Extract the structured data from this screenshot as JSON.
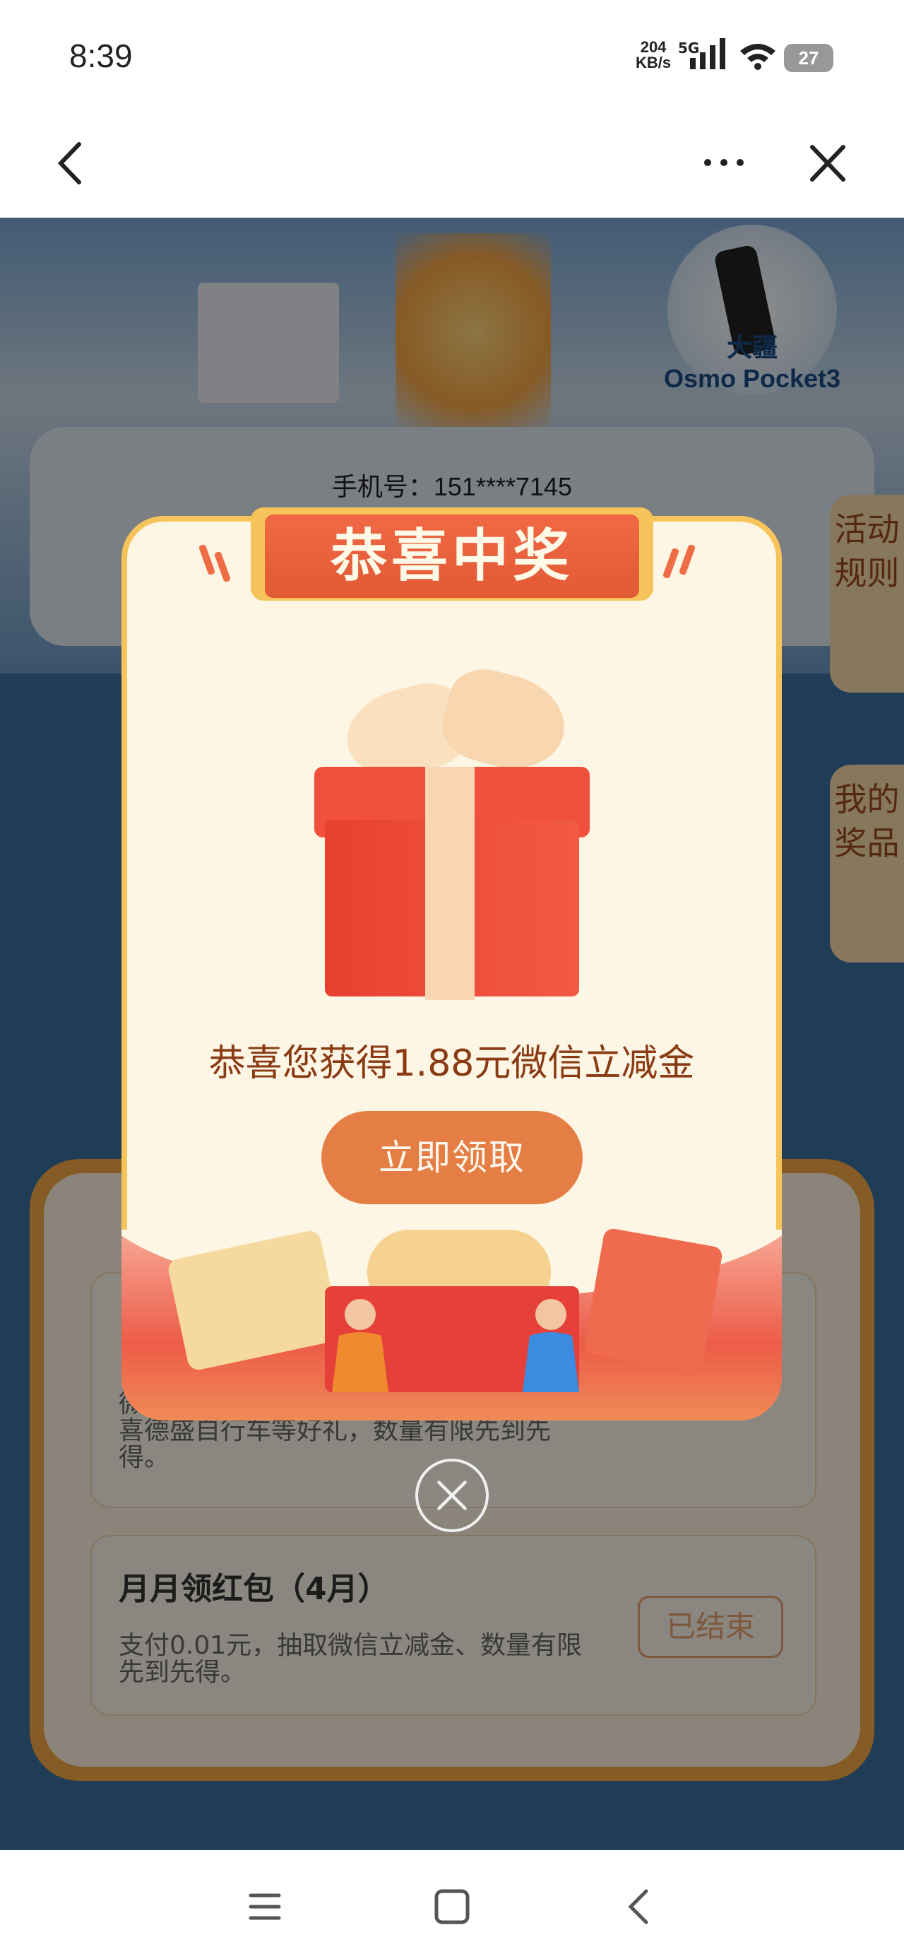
{
  "status_bar": {
    "time": "8:39",
    "net_speed_value": "204",
    "net_speed_unit": "KB/s",
    "network": "5G",
    "battery": "27"
  },
  "nav": {
    "back": "back",
    "more": "more",
    "close": "close"
  },
  "banner": {
    "prize_name_1": "大疆",
    "prize_name_2": "Osmo Pocket3"
  },
  "phone": {
    "label": "手机号：151****7145"
  },
  "side_tabs": [
    {
      "label": "活动规则"
    },
    {
      "label": "我的奖品"
    }
  ],
  "items": [
    {
      "desc": "微信立减金、九号平衡车、大疆Pocket、喜德盛自行车等好礼，数量有限先到先得。"
    },
    {
      "title": "月月领红包（4月）",
      "desc": "支付0.01元，抽取微信立减金、数量有限先到先得。",
      "status": "已结束"
    }
  ],
  "modal": {
    "ribbon_title": "恭喜中奖",
    "prize_text": "恭喜您获得1.88元微信立减金",
    "claim_button": "立即领取"
  },
  "icons": {
    "gift": "gift-box-icon",
    "close": "close-circle-icon"
  },
  "colors": {
    "accent": "#e57e44",
    "ribbon": "#f06844",
    "modal_bg": "#fdf6e4"
  }
}
